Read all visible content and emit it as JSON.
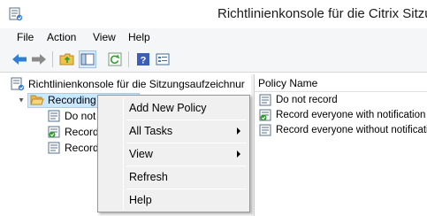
{
  "window": {
    "title": "Richtlinienkonsole für die Citrix Sitzu",
    "app_icon": "console-icon"
  },
  "menubar": {
    "items": [
      {
        "label": "File"
      },
      {
        "label": "Action"
      },
      {
        "label": "View"
      },
      {
        "label": "Help"
      }
    ]
  },
  "toolbar": {
    "buttons": [
      "back-arrow-icon",
      "forward-arrow-icon",
      "folder-up-icon",
      "show-hide-tree-icon",
      "refresh-icon",
      "help-icon",
      "properties-icon"
    ]
  },
  "tree": {
    "root": {
      "label": "Richtlinienkonsole für die Sitzungsaufzeichnur",
      "icon": "console-icon"
    },
    "recording": {
      "label": "Recording",
      "icon": "folder-open-icon",
      "expander": "▲"
    },
    "children": [
      {
        "label": "Do not",
        "icon": "policy-icon"
      },
      {
        "label": "Record",
        "icon": "policy-active-icon"
      },
      {
        "label": "Record",
        "icon": "policy-icon"
      }
    ]
  },
  "list": {
    "column_header": "Policy Name",
    "rows": [
      {
        "label": "Do not record",
        "icon": "policy-icon"
      },
      {
        "label": "Record everyone with notification",
        "icon": "policy-active-icon"
      },
      {
        "label": "Record everyone without notification",
        "icon": "policy-icon"
      }
    ]
  },
  "context_menu": {
    "items": [
      {
        "label": "Add New Policy",
        "submenu": false
      },
      {
        "label": "All Tasks",
        "submenu": true
      },
      {
        "label": "View",
        "submenu": true
      },
      {
        "label": "Refresh",
        "submenu": false
      },
      {
        "label": "Help",
        "submenu": false
      }
    ]
  },
  "colors": {
    "selection": "#cce8ff",
    "arrow_blue": "#2f7fd6",
    "folder_yellow": "#f0c14b",
    "check_green": "#2f9e2f"
  }
}
